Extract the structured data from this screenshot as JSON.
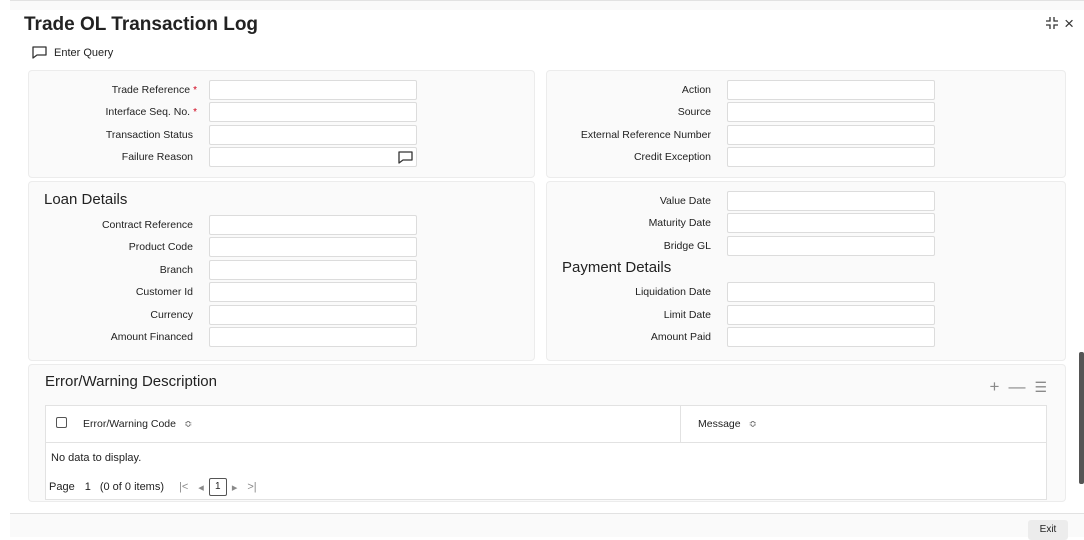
{
  "window": {
    "title": "Trade OL Transaction Log",
    "expand_icon": "expand-icon",
    "close_icon": "close-icon",
    "close_glyph": "×"
  },
  "toolbar": {
    "enter_query": "Enter Query"
  },
  "top_left": {
    "trade_reference": "Trade Reference",
    "interface_seq": "Interface Seq. No.",
    "transaction_status": "Transaction Status",
    "failure_reason": "Failure Reason",
    "required_mark": "*"
  },
  "top_right": {
    "action": "Action",
    "source": "Source",
    "external_reference": "External Reference Number",
    "credit_exception": "Credit Exception"
  },
  "loan": {
    "title": "Loan Details",
    "contract_reference": "Contract Reference",
    "product_code": "Product Code",
    "branch": "Branch",
    "customer_id": "Customer Id",
    "currency": "Currency",
    "amount_financed": "Amount Financed"
  },
  "dates": {
    "value_date": "Value Date",
    "maturity_date": "Maturity Date",
    "bridge_gl": "Bridge GL"
  },
  "payment": {
    "title": "Payment Details",
    "liquidation_date": "Liquidation Date",
    "limit_date": "Limit Date",
    "amount_paid": "Amount Paid"
  },
  "errors": {
    "title": "Error/Warning Description",
    "col_code": "Error/Warning Code",
    "col_message": "Message",
    "no_data": "No data to display.",
    "sort_glyph": "≎",
    "tool_add": "+",
    "tool_remove": "—",
    "tool_cols": "☰"
  },
  "pager": {
    "label": "Page",
    "page": "1",
    "items": "(0 of 0 items)",
    "first": "|<",
    "prev": "◂",
    "current": "1",
    "next": "▸",
    "last": ">|"
  },
  "footer": {
    "exit": "Exit"
  }
}
